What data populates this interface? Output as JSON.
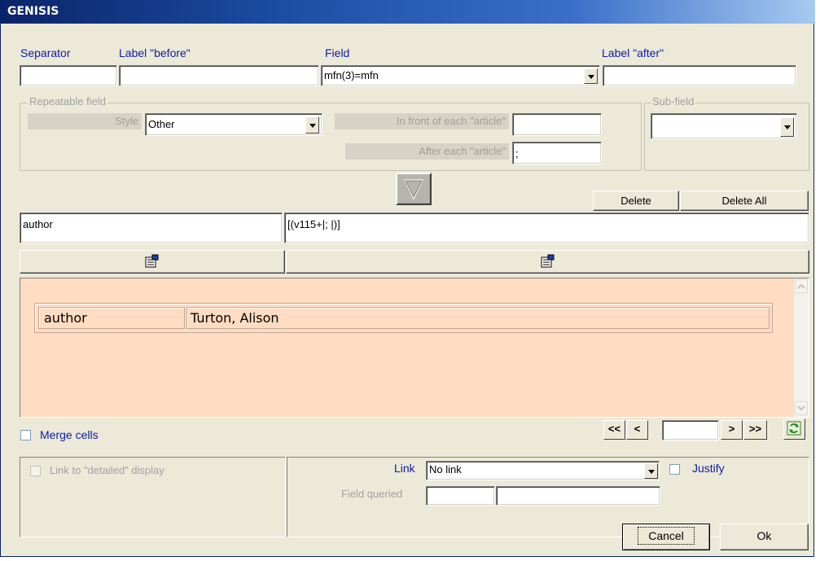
{
  "window": {
    "title": "GENISIS"
  },
  "labels": {
    "separator": "Separator",
    "label_before": "Label \"before\"",
    "field": "Field",
    "label_after": "Label \"after\""
  },
  "inputs": {
    "separator_value": "",
    "label_before_value": "",
    "field_value": "mfn(3)=mfn",
    "label_after_value": ""
  },
  "repeatable": {
    "legend": "Repeatable field",
    "style_label": "Style",
    "style_value": "Other",
    "front_label": "In front of each \"article\"",
    "front_value": "",
    "after_label": "After each \"article\"",
    "after_value": ";"
  },
  "subfield": {
    "legend": "Sub-field",
    "value": ""
  },
  "buttons": {
    "delete": "Delete",
    "delete_all": "Delete All",
    "cancel": "Cancel",
    "ok": "Ok"
  },
  "definition": {
    "name": "author",
    "expression": "[(v115+|; |)]"
  },
  "preview": {
    "rows": [
      {
        "label": "author",
        "value": "Turton, Alison"
      }
    ],
    "bg_color": "#ffdcc2"
  },
  "merge_cells_label": "Merge cells",
  "navigation": {
    "first": "<<",
    "prev": "<",
    "page_value": "",
    "next": ">",
    "last": ">>"
  },
  "bottom": {
    "link_detailed": "Link to \"detailed\" display",
    "link_label": "Link",
    "link_value": "No link",
    "justify": "Justify",
    "field_queried_label": "Field queried",
    "field_queried_value1": "",
    "field_queried_value2": ""
  },
  "icons": {
    "move_down": "triangle-down-icon",
    "properties": "properties-icon",
    "refresh": "refresh-icon"
  }
}
